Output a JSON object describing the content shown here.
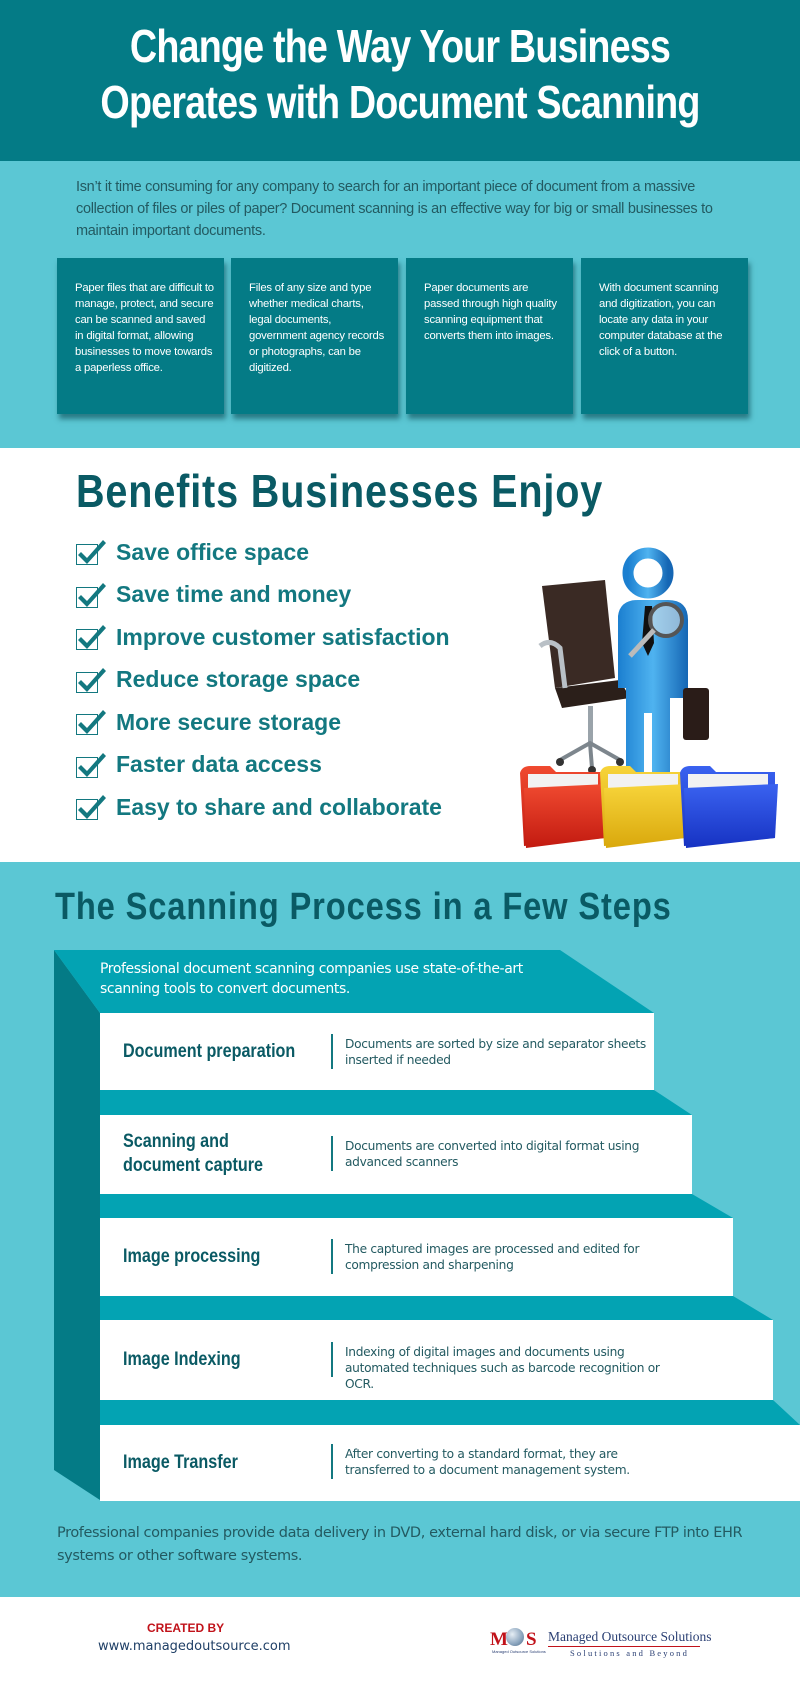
{
  "colors": {
    "header_bg": "#047b86",
    "panel_bg": "#5bc7d4",
    "heading": "#0a5a64",
    "accent": "#137880",
    "stair_slab": "#03a3b3",
    "stair_side": "#047b86",
    "brand_red": "#c1121a"
  },
  "header": {
    "title_line1": "Change the Way Your Business",
    "title_line2": "Operates with Document Scanning"
  },
  "intro": {
    "text": "Isn’t it time consuming for any company to search for an important piece of document from a massive collection of files or piles of paper? Document scanning is an effective way for big or small businesses to maintain important documents.",
    "cards": [
      {
        "text": "Paper files that are difficult to manage, protect, and secure can be scanned and saved in digital format, allowing businesses to move towards a paperless office."
      },
      {
        "text": "Files of any size and type whether medical charts, legal documents, government agency records or photographs, can be digitized."
      },
      {
        "text": "Paper documents are passed through high quality scanning equipment that converts them into images."
      },
      {
        "text": "With document scanning and digitization, you can locate any data in your computer database at the click of a button."
      }
    ]
  },
  "benefits": {
    "title": "Benefits Businesses Enjoy",
    "items": [
      {
        "label": "Save office space",
        "checked": true
      },
      {
        "label": "Save time and money",
        "checked": true
      },
      {
        "label": "Improve customer satisfaction",
        "checked": true
      },
      {
        "label": "Reduce storage space",
        "checked": true
      },
      {
        "label": "More secure storage",
        "checked": true
      },
      {
        "label": "Faster data access",
        "checked": true
      },
      {
        "label": "Easy to share and collaborate",
        "checked": true
      }
    ],
    "illustration": "businessman-figure-with-magnifier-chair-and-folders"
  },
  "process": {
    "title": "The Scanning Process in a Few Steps",
    "intro": "Professional document scanning companies use state-of-the-art scanning tools to convert documents.",
    "steps": [
      {
        "title_line1": "Document preparation",
        "title_line2": "",
        "description": "Documents are sorted by size and separator sheets inserted if needed"
      },
      {
        "title_line1": "Scanning and",
        "title_line2": "document capture",
        "description": "Documents are converted into digital format using advanced scanners"
      },
      {
        "title_line1": "Image processing",
        "title_line2": "",
        "description": "The captured images are processed and edited for compression and sharpening"
      },
      {
        "title_line1": "Image Indexing",
        "title_line2": "",
        "description": "Indexing of digital images and documents using automated techniques such as barcode recognition or OCR."
      },
      {
        "title_line1": "Image Transfer",
        "title_line2": "",
        "description": "After converting to a standard format, they are transferred to a document management system."
      }
    ],
    "outro": "Professional companies provide data delivery in DVD, external hard disk, or via secure FTP into EHR systems or other software systems."
  },
  "footer": {
    "created_by": "CREATED BY",
    "url": "www.managedoutsource.com",
    "logo": {
      "mark_left": "M",
      "mark_right": "S",
      "mark_sub": "Managed Outsource Solutions",
      "name": "Managed Outsource Solutions",
      "tagline": "Solutions and Beyond"
    }
  }
}
